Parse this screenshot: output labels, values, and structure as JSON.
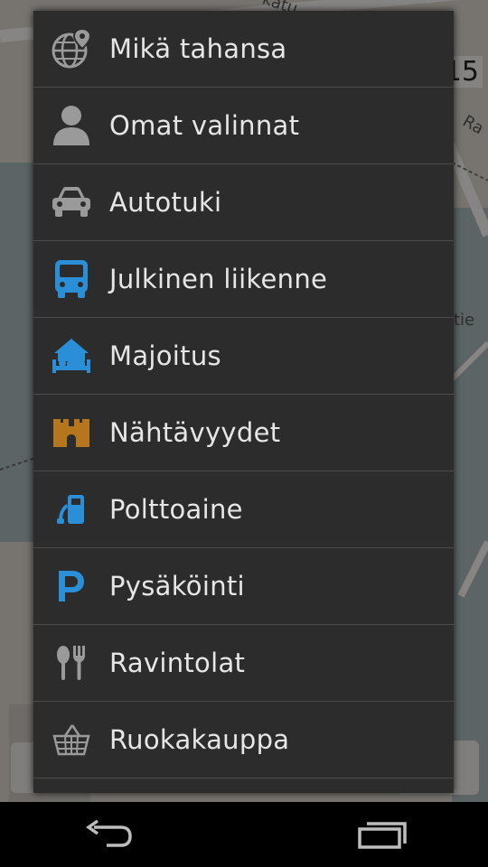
{
  "map": {
    "street_labels": [
      "katu",
      "Ra",
      "tie"
    ],
    "zoom_text": "15"
  },
  "menu": {
    "items": [
      {
        "label": "Mikä tahansa",
        "icon": "globe-pin-icon"
      },
      {
        "label": "Omat valinnat",
        "icon": "person-icon"
      },
      {
        "label": "Autotuki",
        "icon": "car-icon"
      },
      {
        "label": "Julkinen liikenne",
        "icon": "bus-icon"
      },
      {
        "label": "Majoitus",
        "icon": "bed-icon"
      },
      {
        "label": "Nähtävyydet",
        "icon": "castle-icon"
      },
      {
        "label": "Polttoaine",
        "icon": "fuel-pump-icon"
      },
      {
        "label": "Pysäköinti",
        "icon": "parking-icon"
      },
      {
        "label": "Ravintolat",
        "icon": "cutlery-icon"
      },
      {
        "label": "Ruokakauppa",
        "icon": "basket-icon"
      }
    ]
  },
  "colors": {
    "menu_bg": "#2c2c2c",
    "text": "#e6e6e6",
    "icon_gray": "#9a9a9a",
    "icon_blue": "#2a8fd6",
    "icon_brown": "#b5761e"
  },
  "navbar": {
    "back_icon": "back-arrow-icon",
    "recents_icon": "recent-apps-icon"
  }
}
